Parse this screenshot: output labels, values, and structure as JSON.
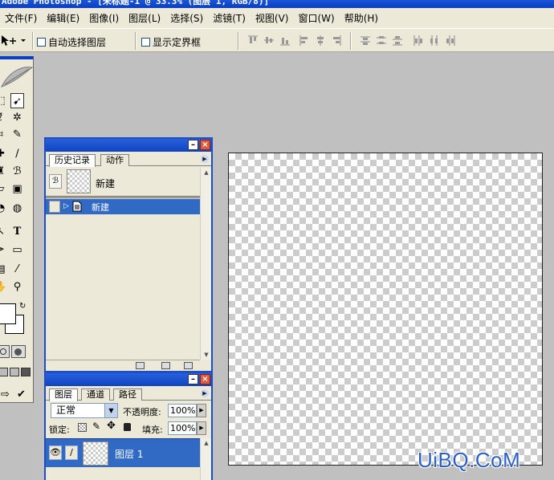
{
  "app": {
    "title": "Adobe Photoshop - [未标题-1 @ 33.3% (图层 1, RGB/8)]"
  },
  "menu": [
    "文件(F)",
    "编辑(E)",
    "图像(I)",
    "图层(L)",
    "选择(S)",
    "滤镜(T)",
    "视图(V)",
    "窗口(W)",
    "帮助(H)"
  ],
  "options": {
    "tool_icon": "move-tool-icon",
    "auto_select_label": "自动选择图层",
    "show_bounds_label": "显示定界框",
    "auto_select_checked": false,
    "show_bounds_checked": false
  },
  "history": {
    "tabs": [
      "历史记录",
      "动作"
    ],
    "snapshot_label": "新建",
    "steps": [
      {
        "label": "新建",
        "selected": true
      }
    ]
  },
  "layers": {
    "tabs": [
      "图层",
      "通道",
      "路径"
    ],
    "blend_mode": "正常",
    "opacity_label": "不透明度:",
    "opacity_value": "100%",
    "lock_label": "锁定:",
    "fill_label": "填充:",
    "fill_value": "100%",
    "items": [
      {
        "name": "图层 1",
        "visible": true,
        "selected": true
      }
    ]
  },
  "watermark": "UiBQ.CoM",
  "colors": {
    "title_blue": "#0a3fbf",
    "selection_blue": "#316ac5",
    "panel_bg": "#ece9d8",
    "workspace_gray": "#c0c0c0",
    "watermark_blue": "#2a5fc8"
  }
}
